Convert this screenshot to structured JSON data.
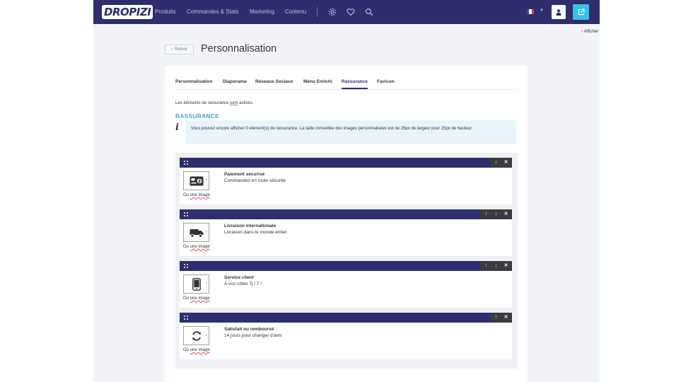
{
  "header": {
    "logo": "DROPIZI",
    "nav": [
      "Produits",
      "Commandes & Stats",
      "Marketing",
      "Contenu"
    ],
    "icons": [
      "gear-icon",
      "heart-icon",
      "search-icon",
      "user-icon",
      "external-link-icon"
    ],
    "language_flag": "fr"
  },
  "toolbar": {
    "afficher_label": "Afficher"
  },
  "page": {
    "back_label": "Retour",
    "title": "Personnalisation"
  },
  "tabs": [
    {
      "label": "Personnalisation",
      "active": false
    },
    {
      "label": "Diaporama",
      "active": false
    },
    {
      "label": "Réseaux Sociaux",
      "active": false
    },
    {
      "label": "Menu Enrichi",
      "active": false
    },
    {
      "label": "Rassurance",
      "active": true
    },
    {
      "label": "Favicon",
      "active": false
    }
  ],
  "status": {
    "prefix": "Les éléments de rassurance ",
    "word": "sont",
    "suffix": " activés."
  },
  "section": {
    "title": "RASSURANCE",
    "info": "Vous pouvez encore afficher 0 élément(s) de rassurance. La taille conseillée des images personnalisées est de 25px de largeur pour 25px de hauteur."
  },
  "items": [
    {
      "title": "Paiement sécurisé",
      "subtitle": "Commandez en toute sécurité",
      "icon": "credit-card-icon",
      "alt_prefix": "Ou ",
      "alt_link": "une image",
      "actions": [
        "↓",
        "✕"
      ]
    },
    {
      "title": "Livraison internationale",
      "subtitle": "Livraison dans le monde entier",
      "icon": "truck-icon",
      "alt_prefix": "Ou ",
      "alt_link": "une image",
      "actions": [
        "↑",
        "↓",
        "✕"
      ]
    },
    {
      "title": "Service client",
      "subtitle": "À vos côtés 7j / 7 !",
      "icon": "smartphone-icon",
      "alt_prefix": "Ou ",
      "alt_link": "une image",
      "actions": [
        "↑",
        "↓",
        "✕"
      ]
    },
    {
      "title": "Satisfait ou remboursé",
      "subtitle": "14 jours pour changer d'avis",
      "icon": "refresh-icon",
      "alt_prefix": "Ou ",
      "alt_link": "une image",
      "actions": [
        "↑",
        "✕"
      ]
    }
  ],
  "colors": {
    "navy": "#2e2e6e",
    "accent": "#38c1e6",
    "section_title": "#4aa3cf",
    "info_bg": "#e8f4fb"
  }
}
